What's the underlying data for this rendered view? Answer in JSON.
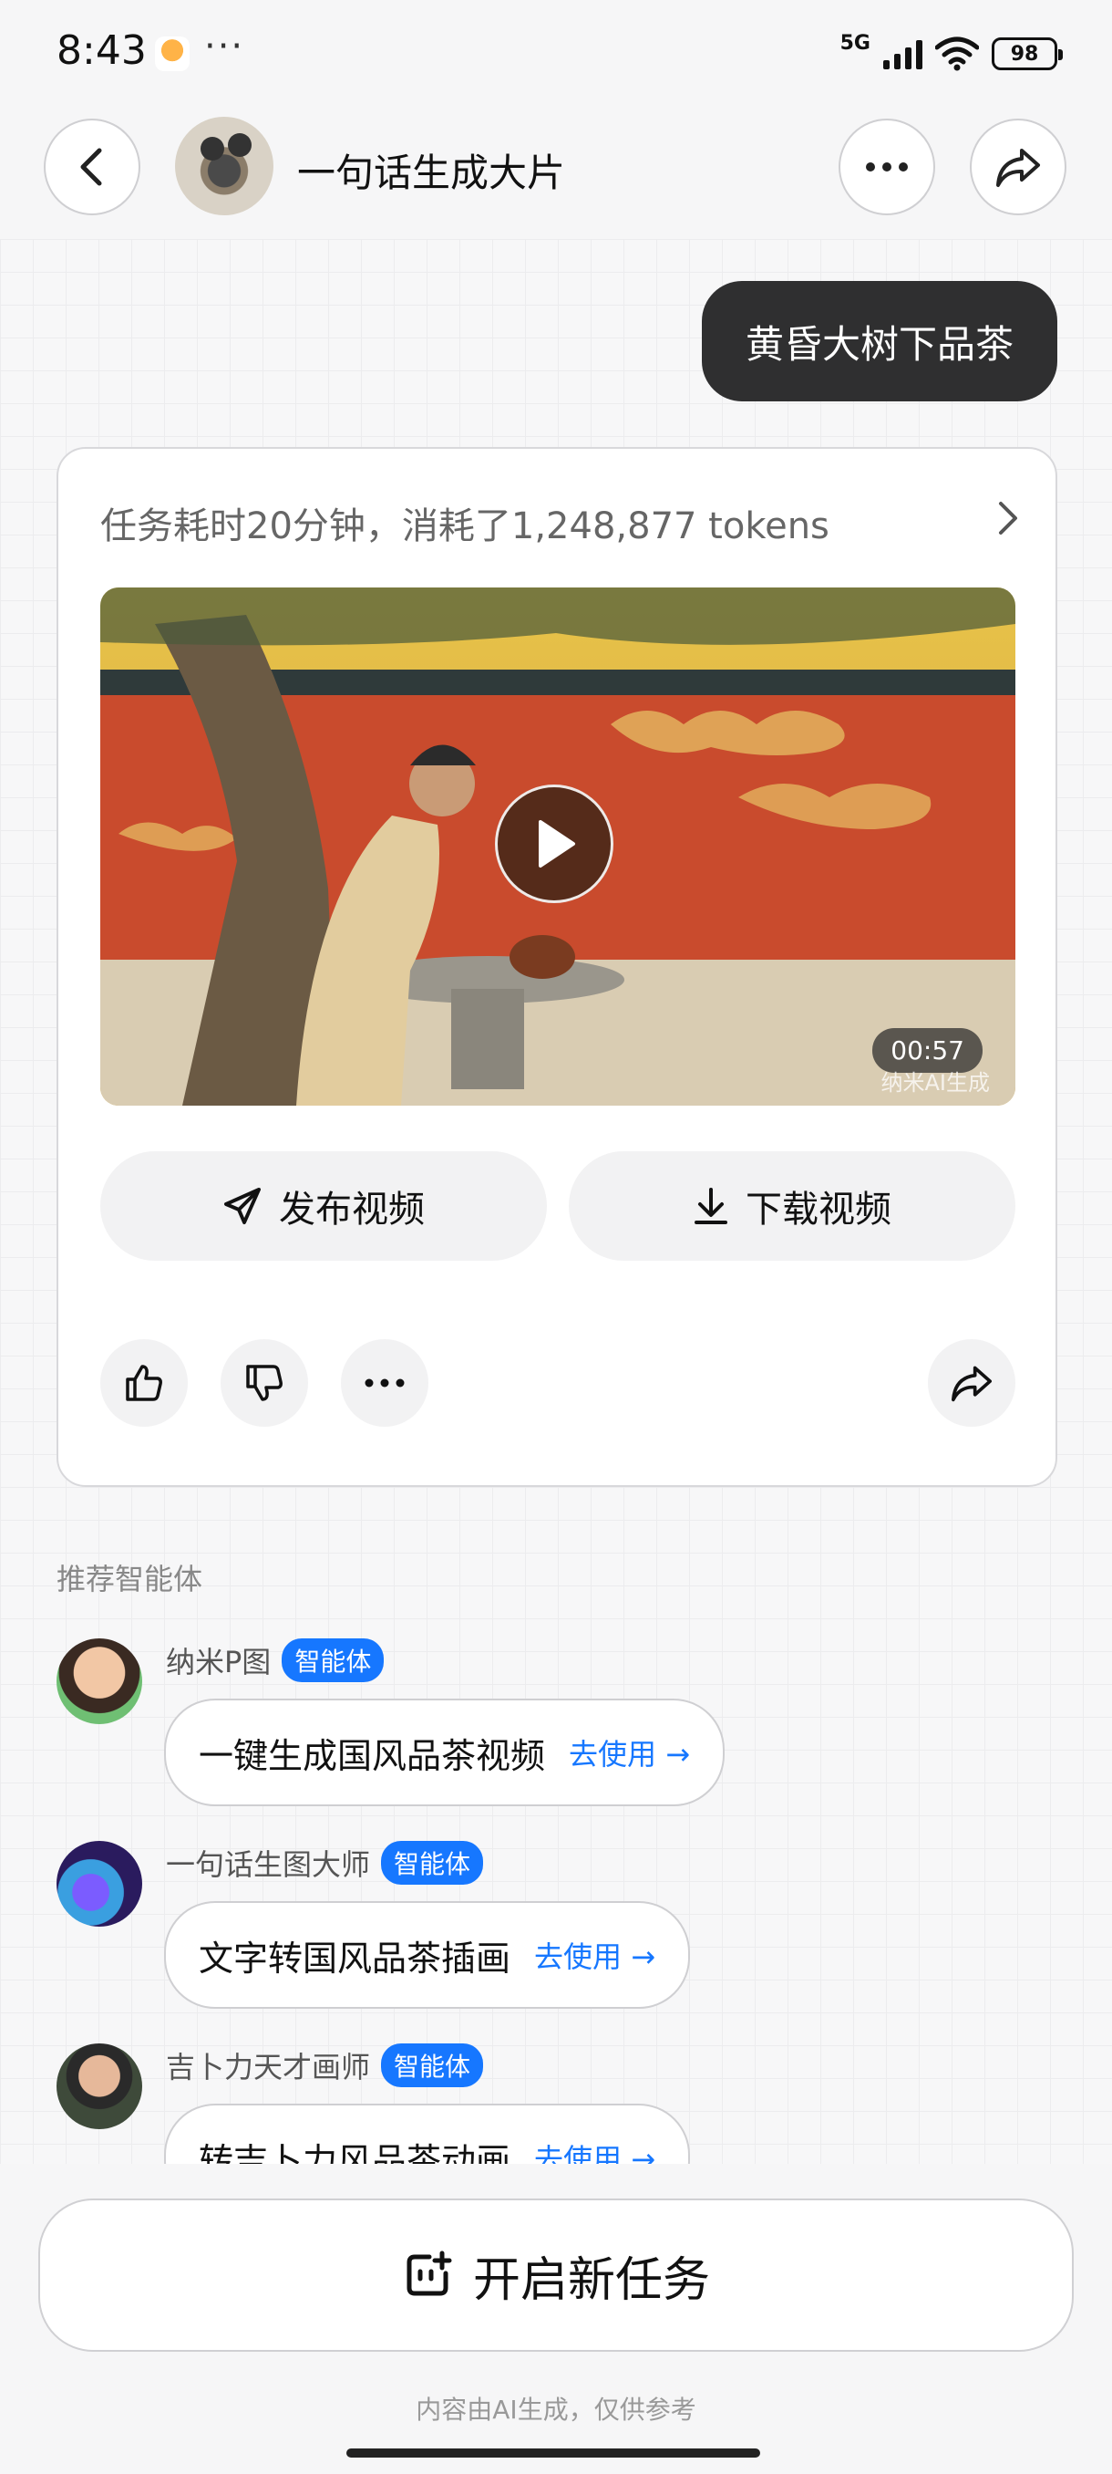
{
  "status_bar": {
    "time": "8:43",
    "network": "5G",
    "battery": "98",
    "more": "···"
  },
  "header": {
    "title": "一句话生成大片"
  },
  "chat": {
    "user_message": "黄昏大树下品茶",
    "result": {
      "task_summary": "任务耗时20分钟，消耗了1,248,877 tokens",
      "video_duration": "00:57",
      "watermark": "纳米AI生成",
      "publish_label": "发布视频",
      "download_label": "下载视频"
    }
  },
  "recommended": {
    "title": "推荐智能体",
    "agents": [
      {
        "name": "纳米P图",
        "badge": "智能体",
        "prompt": "一键生成国风品茶视频",
        "action": "去使用 →"
      },
      {
        "name": "一句话生图大师",
        "badge": "智能体",
        "prompt": "文字转国风品茶插画",
        "action": "去使用 →"
      },
      {
        "name": "吉卜力天才画师",
        "badge": "智能体",
        "prompt": "转吉卜力风品茶动画",
        "action": "去使用 →"
      }
    ]
  },
  "footer": {
    "new_task_label": "开启新任务",
    "disclaimer": "内容由AI生成，仅供参考"
  }
}
